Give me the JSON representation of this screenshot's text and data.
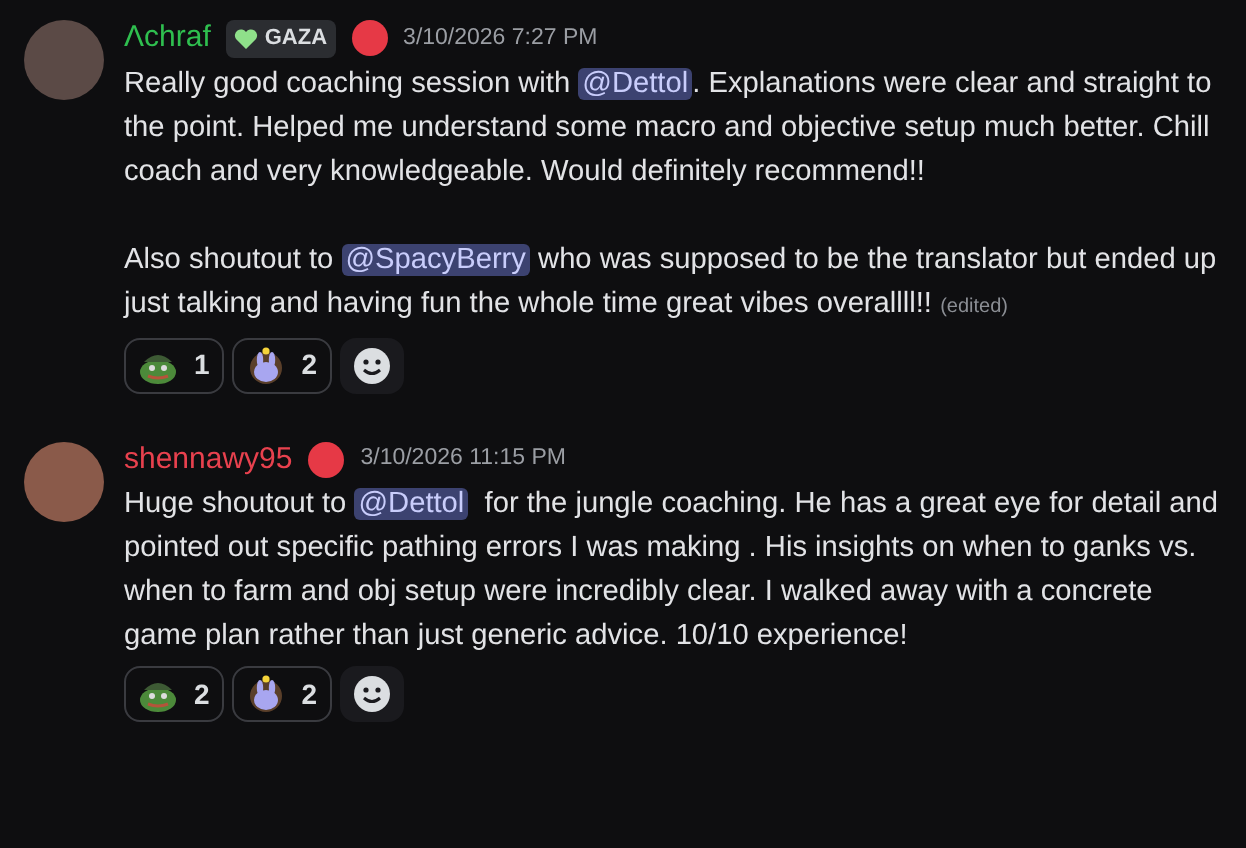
{
  "messages": [
    {
      "author": {
        "name": "Λchraf",
        "color": "#2fbf4f"
      },
      "tag": {
        "label": "GAZA"
      },
      "timestamp": "3/10/2026 7:27 PM",
      "paragraphs": [
        [
          {
            "kind": "text",
            "text": "Really good coaching session with "
          },
          {
            "kind": "mention",
            "text": "@Dettol"
          },
          {
            "kind": "text",
            "text": ". Explanations were clear and straight to the point. Helped me understand some macro and objective setup much better. Chill coach and very knowledgeable. Would definitely recommend!!"
          }
        ],
        [
          {
            "kind": "text",
            "text": "Also shoutout to "
          },
          {
            "kind": "mention",
            "text": "@SpacyBerry"
          },
          {
            "kind": "text",
            "text": " who was supposed to be the translator but ended up just talking and having fun the whole time great vibes overallll!!"
          }
        ]
      ],
      "edited": "(edited)",
      "reactions": [
        {
          "kind": "frog",
          "count": "1"
        },
        {
          "kind": "bunny",
          "count": "2"
        }
      ]
    },
    {
      "author": {
        "name": "shennawy95",
        "color": "#e8414e"
      },
      "timestamp": "3/10/2026 11:15 PM",
      "paragraphs": [
        [
          {
            "kind": "text",
            "text": "Huge shoutout to "
          },
          {
            "kind": "mention",
            "text": "@Dettol"
          },
          {
            "kind": "text",
            "text": "  for the jungle coaching. He has a great eye for detail and pointed out specific pathing errors I was making . His insights on when to ganks vs. when to farm and obj setup were incredibly clear. I walked away with a concrete game plan rather than just generic advice. 10/10 experience!"
          }
        ]
      ],
      "reactions": [
        {
          "kind": "frog",
          "count": "2"
        },
        {
          "kind": "bunny",
          "count": "2"
        }
      ]
    }
  ]
}
